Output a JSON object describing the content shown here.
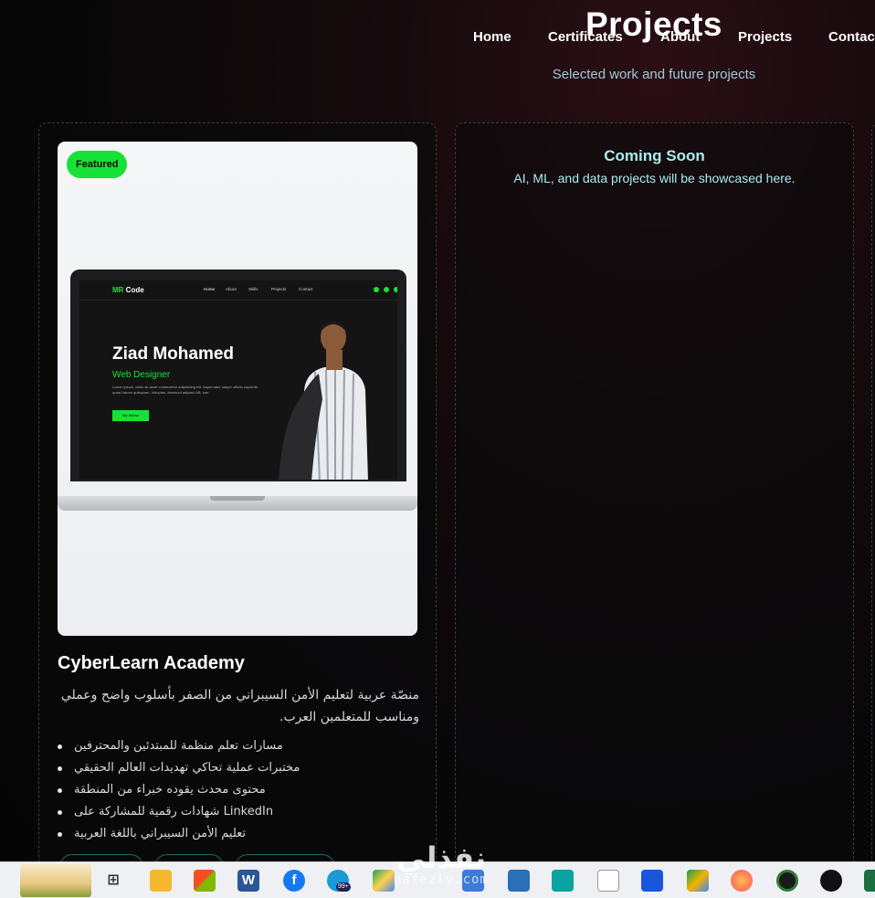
{
  "nav": {
    "items": [
      "Home",
      "Certificates",
      "About",
      "Projects",
      "Contac"
    ]
  },
  "header": {
    "title": "Projects",
    "subtitle": "Selected work and future projects"
  },
  "featured_project": {
    "badge": "Featured",
    "preview": {
      "logo_a": "MR",
      "logo_b": " Code",
      "nav": [
        "Home",
        "About",
        "Skills",
        "Projects",
        "Contact"
      ],
      "name": "Ziad Mohamed",
      "role": "Web Designer",
      "lorem": "Lorem ipsum, dolor sit amet consectetur adipisicing elit. Aspernatur saepe officiis sapiente quasi harum quisquam. Voluptas, deserunt adipisci AB, iure",
      "button": "My Works"
    },
    "title": "CyberLearn Academy",
    "description": "منصّة عربية لتعليم الأمن السيبراني من الصفر بأسلوب واضح وعملي ومناسب للمتعلمين العرب.",
    "features": [
      "مسارات تعلم منظمة للمبتدئين والمحترفين",
      "مختبرات عملية تحاكي تهديدات العالم الحقيقي",
      "محتوى محدث يقوده خبراء من المنطقة",
      "شهادات رقمية للمشاركة على LinkedIn",
      "تعليم الأمن السيبراني باللغة العربية"
    ]
  },
  "coming_soon": {
    "title": "Coming Soon",
    "text": "AI, ML, and data projects will be showcased here."
  },
  "taskbar": {
    "badge_count": "99+",
    "word_letter": "W",
    "facebook_letter": "f"
  },
  "watermark": {
    "arabic": "نفذلي",
    "latin": "nafezly.com"
  },
  "colors": {
    "accent_green": "#16e236",
    "accent_cyan": "#a9ecf1",
    "subtitle_blue": "#9fc9da"
  }
}
